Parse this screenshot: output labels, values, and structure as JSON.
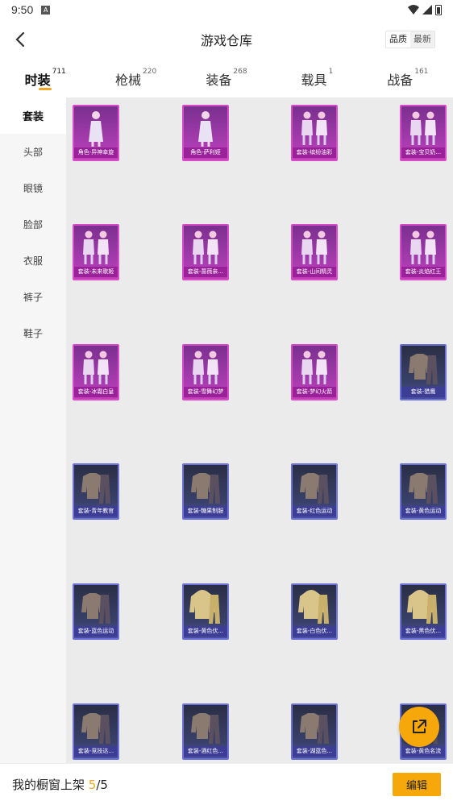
{
  "status_bar": {
    "time": "9:50",
    "notif_letter": "A"
  },
  "header": {
    "title": "游戏仓库",
    "sort_options": [
      {
        "label": "品质",
        "active": true
      },
      {
        "label": "最新",
        "active": false
      }
    ]
  },
  "tabs": [
    {
      "label": "时装",
      "count": "711",
      "active": true
    },
    {
      "label": "枪械",
      "count": "220",
      "active": false
    },
    {
      "label": "装备",
      "count": "268",
      "active": false
    },
    {
      "label": "载具",
      "count": "1",
      "active": false
    },
    {
      "label": "战备",
      "count": "161",
      "active": false
    }
  ],
  "sidebar": {
    "items": [
      {
        "label": "套装",
        "active": true
      },
      {
        "label": "头部",
        "active": false
      },
      {
        "label": "眼镜",
        "active": false
      },
      {
        "label": "脸部",
        "active": false
      },
      {
        "label": "衣服",
        "active": false
      },
      {
        "label": "裤子",
        "active": false
      },
      {
        "label": "鞋子",
        "active": false
      }
    ]
  },
  "items": [
    {
      "name": "角色-异神幸旋",
      "rarity": "pink",
      "icon": "character-icon"
    },
    {
      "name": "角色-萨利娅",
      "rarity": "pink",
      "icon": "character-icon"
    },
    {
      "name": "套装-缤纷油彩",
      "rarity": "pink",
      "icon": "outfit-pair-icon"
    },
    {
      "name": "套装-宝贝奶...",
      "rarity": "pink",
      "icon": "outfit-pair-icon"
    },
    {
      "name": "套装-未来歌姬",
      "rarity": "pink",
      "icon": "outfit-pair-icon"
    },
    {
      "name": "套装-蔷薇亲...",
      "rarity": "pink",
      "icon": "outfit-pair-icon"
    },
    {
      "name": "套装-山间精灵",
      "rarity": "pink",
      "icon": "outfit-pair-icon"
    },
    {
      "name": "套装-炎焰红王",
      "rarity": "pink",
      "icon": "outfit-pair-icon"
    },
    {
      "name": "套装-冰霜白皇",
      "rarity": "pink",
      "icon": "outfit-pair-icon"
    },
    {
      "name": "套装-雪舞幻梦",
      "rarity": "pink",
      "icon": "outfit-pair-icon"
    },
    {
      "name": "套装-梦幻火箭",
      "rarity": "pink",
      "icon": "outfit-pair-icon"
    },
    {
      "name": "套装-猎鹰",
      "rarity": "blue",
      "icon": "jacket-icon"
    },
    {
      "name": "套装-青年教官",
      "rarity": "blue",
      "icon": "jacket-icon"
    },
    {
      "name": "套装-糖果制服",
      "rarity": "blue",
      "icon": "jacket-icon"
    },
    {
      "name": "套装-红色运动",
      "rarity": "blue",
      "icon": "jacket-icon"
    },
    {
      "name": "套装-黄色运动",
      "rarity": "blue",
      "icon": "jacket-icon"
    },
    {
      "name": "套装-蓝色运动",
      "rarity": "blue",
      "icon": "jacket-icon"
    },
    {
      "name": "套装-黄色伏...",
      "rarity": "blue",
      "icon": "hoodie-icon"
    },
    {
      "name": "套装-白色伏...",
      "rarity": "blue",
      "icon": "hoodie-icon"
    },
    {
      "name": "套装-黑色伏...",
      "rarity": "blue",
      "icon": "hoodie-icon"
    },
    {
      "name": "套装-竞技达...",
      "rarity": "blue",
      "icon": "jacket-icon"
    },
    {
      "name": "套装-酒红色...",
      "rarity": "blue",
      "icon": "jacket-icon"
    },
    {
      "name": "套装-湖蓝色...",
      "rarity": "blue",
      "icon": "jacket-icon"
    },
    {
      "name": "套装-黄色名流",
      "rarity": "blue",
      "icon": "jacket-icon"
    }
  ],
  "fab": {
    "icon": "share-external-icon"
  },
  "bottom_bar": {
    "prefix": "我的橱窗上架",
    "current": "5",
    "separator": "/",
    "total": "5",
    "edit_label": "编辑"
  },
  "colors": {
    "accent": "#f6a80b",
    "pink_rarity": "#c23fb8",
    "blue_rarity": "#4a4fa0"
  }
}
